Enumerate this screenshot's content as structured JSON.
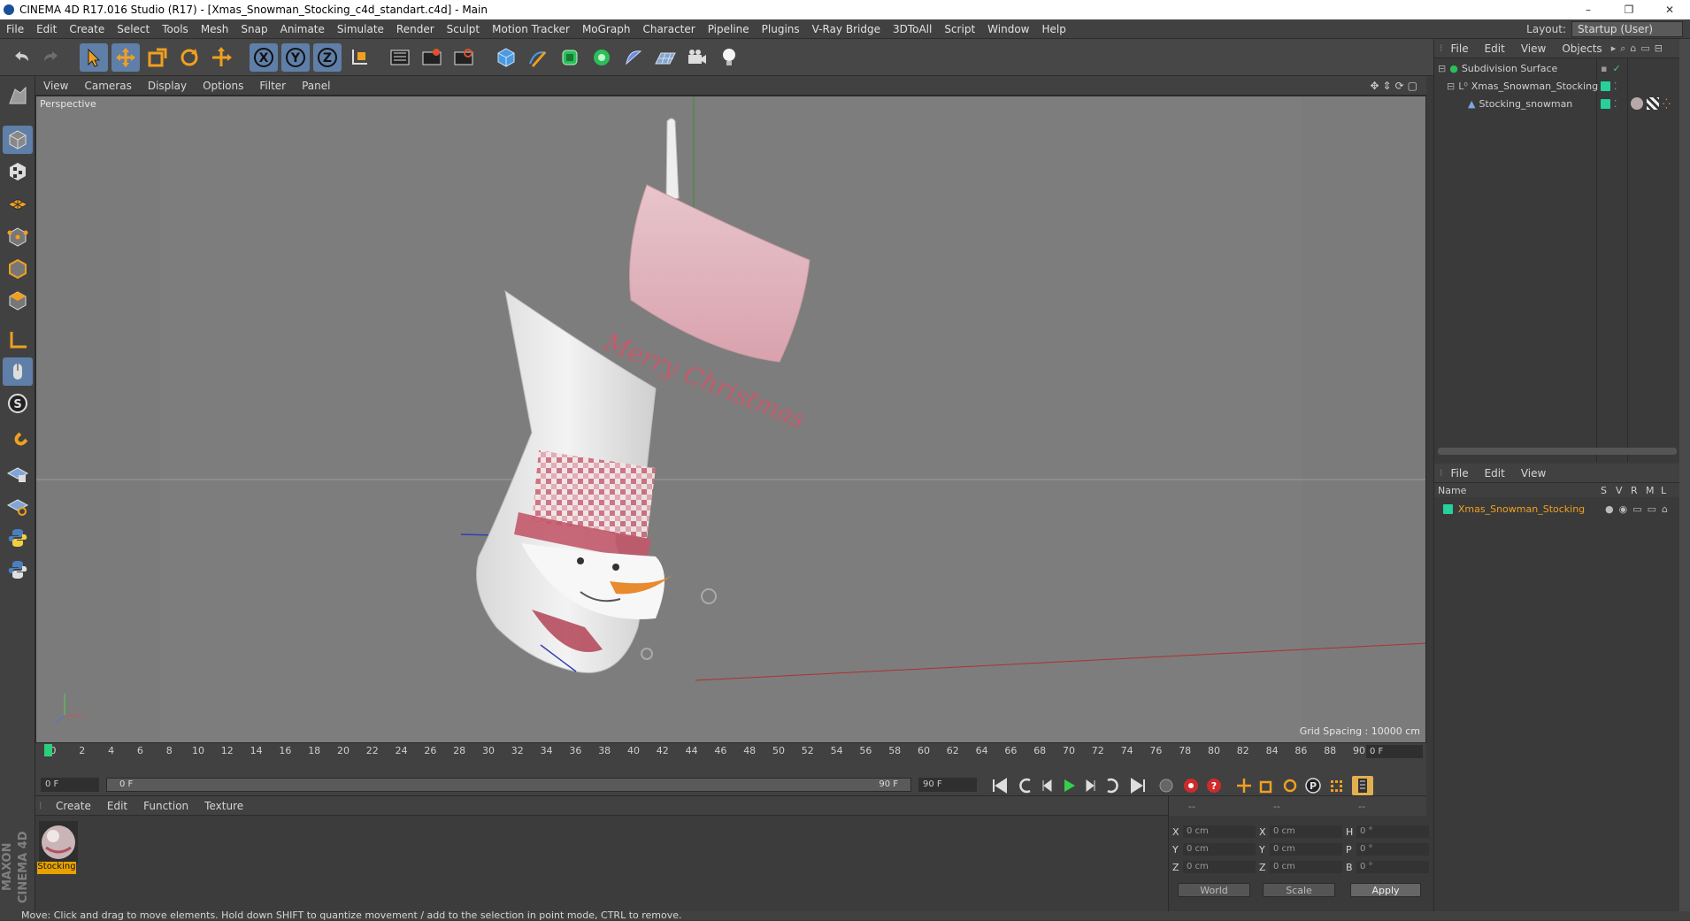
{
  "window": {
    "title": "CINEMA 4D R17.016 Studio (R17) - [Xmas_Snowman_Stocking_c4d_standart.c4d] - Main",
    "controls": [
      "–",
      "❐",
      "✕"
    ]
  },
  "menubar": [
    "File",
    "Edit",
    "Create",
    "Select",
    "Tools",
    "Mesh",
    "Snap",
    "Animate",
    "Simulate",
    "Render",
    "Sculpt",
    "Motion Tracker",
    "MoGraph",
    "Character",
    "Pipeline",
    "Plugins",
    "V-Ray Bridge",
    "3DToAll",
    "Script",
    "Window",
    "Help"
  ],
  "layout": {
    "label": "Layout:",
    "value": "Startup (User)"
  },
  "viewport": {
    "menu": [
      "View",
      "Cameras",
      "Display",
      "Options",
      "Filter",
      "Panel"
    ],
    "label": "Perspective",
    "grid_spacing": "Grid Spacing : 10000 cm",
    "stocking_text": "Merry Christmas",
    "colors": {
      "bg": "#7a7a7a",
      "cuff": "#e4b8c0",
      "body": "#ededed",
      "accent": "#c25b6a",
      "carrot": "#e88a2e"
    }
  },
  "timeline": {
    "frames": [
      "0",
      "2",
      "4",
      "6",
      "8",
      "10",
      "12",
      "14",
      "16",
      "18",
      "20",
      "22",
      "24",
      "26",
      "28",
      "30",
      "32",
      "34",
      "36",
      "38",
      "40",
      "42",
      "44",
      "46",
      "48",
      "50",
      "52",
      "54",
      "56",
      "58",
      "60",
      "62",
      "64",
      "66",
      "68",
      "70",
      "72",
      "74",
      "76",
      "78",
      "80",
      "82",
      "84",
      "86",
      "88",
      "90"
    ],
    "current": "0 F",
    "start": "0 F",
    "range_start": "0 F",
    "range_end": "90 F",
    "end": "90 F"
  },
  "materials": {
    "menu": [
      "Create",
      "Edit",
      "Function",
      "Texture"
    ],
    "items": [
      {
        "name": "Stocking"
      }
    ]
  },
  "coordinates": {
    "header": [
      "--",
      "--",
      "--"
    ],
    "rows": [
      {
        "a": "X",
        "av": "0 cm",
        "b": "X",
        "bv": "0 cm",
        "c": "H",
        "cv": "0 °"
      },
      {
        "a": "Y",
        "av": "0 cm",
        "b": "Y",
        "bv": "0 cm",
        "c": "P",
        "cv": "0 °"
      },
      {
        "a": "Z",
        "av": "0 cm",
        "b": "Z",
        "bv": "0 cm",
        "c": "B",
        "cv": "0 °"
      }
    ],
    "mode1": "World",
    "mode2": "Scale",
    "apply": "Apply"
  },
  "objects": {
    "menu": [
      "File",
      "Edit",
      "View",
      "Objects"
    ],
    "items": [
      {
        "name": "Subdivision Surface",
        "depth": 0
      },
      {
        "name": "Xmas_Snowman_Stocking",
        "depth": 1
      },
      {
        "name": "Stocking_snowman",
        "depth": 2
      }
    ]
  },
  "layers": {
    "menu": [
      "File",
      "Edit",
      "View"
    ],
    "columns": [
      "Name",
      "S",
      "V",
      "R",
      "M",
      "L"
    ],
    "items": [
      {
        "name": "Xmas_Snowman_Stocking"
      }
    ]
  },
  "status": "Move: Click and drag to move elements. Hold down SHIFT to quantize movement / add to the selection in point mode, CTRL to remove.",
  "maxon_logo": "MAXON CINEMA 4D"
}
